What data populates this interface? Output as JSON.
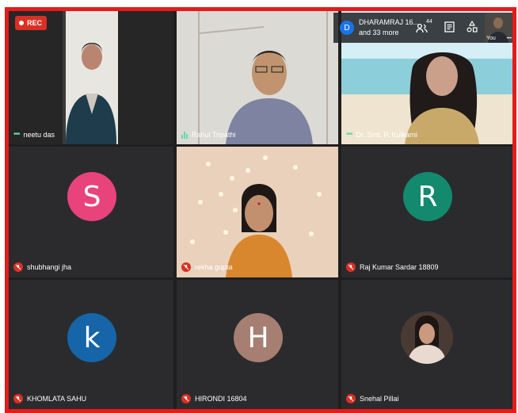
{
  "recording": {
    "label": "REC"
  },
  "topbar": {
    "presenter_initial": "D",
    "presenter_name": "DHARAMRAJ 16...",
    "others": "and 33 more",
    "people_count": "44",
    "self_label": "You",
    "more_label": "•••"
  },
  "participants": [
    {
      "name": "neetu das",
      "status": "video"
    },
    {
      "name": "Rahul Tripathi",
      "status": "speaking"
    },
    {
      "name": "Dr. Smt. P. Kulkarni",
      "status": "video"
    },
    {
      "name": "shubhangi jha",
      "initial": "S",
      "avatar_color": "#e8437a",
      "status": "muted"
    },
    {
      "name": "rekha gupta",
      "status": "muted"
    },
    {
      "name": "Raj Kumar Sardar 18809",
      "initial": "R",
      "avatar_color": "#138a6e",
      "status": "muted"
    },
    {
      "name": "KHOMLATA SAHU",
      "initial": "k",
      "avatar_color": "#1565a8",
      "status": "muted"
    },
    {
      "name": "HIRONDI 16804",
      "initial": "H",
      "avatar_color": "#a67f72",
      "status": "muted"
    },
    {
      "name": "Snehal Pillai",
      "status": "muted"
    }
  ],
  "colors": {
    "frame_border": "#e51b1b",
    "muted_badge": "#d93025",
    "speaking": "#66d9a8"
  }
}
